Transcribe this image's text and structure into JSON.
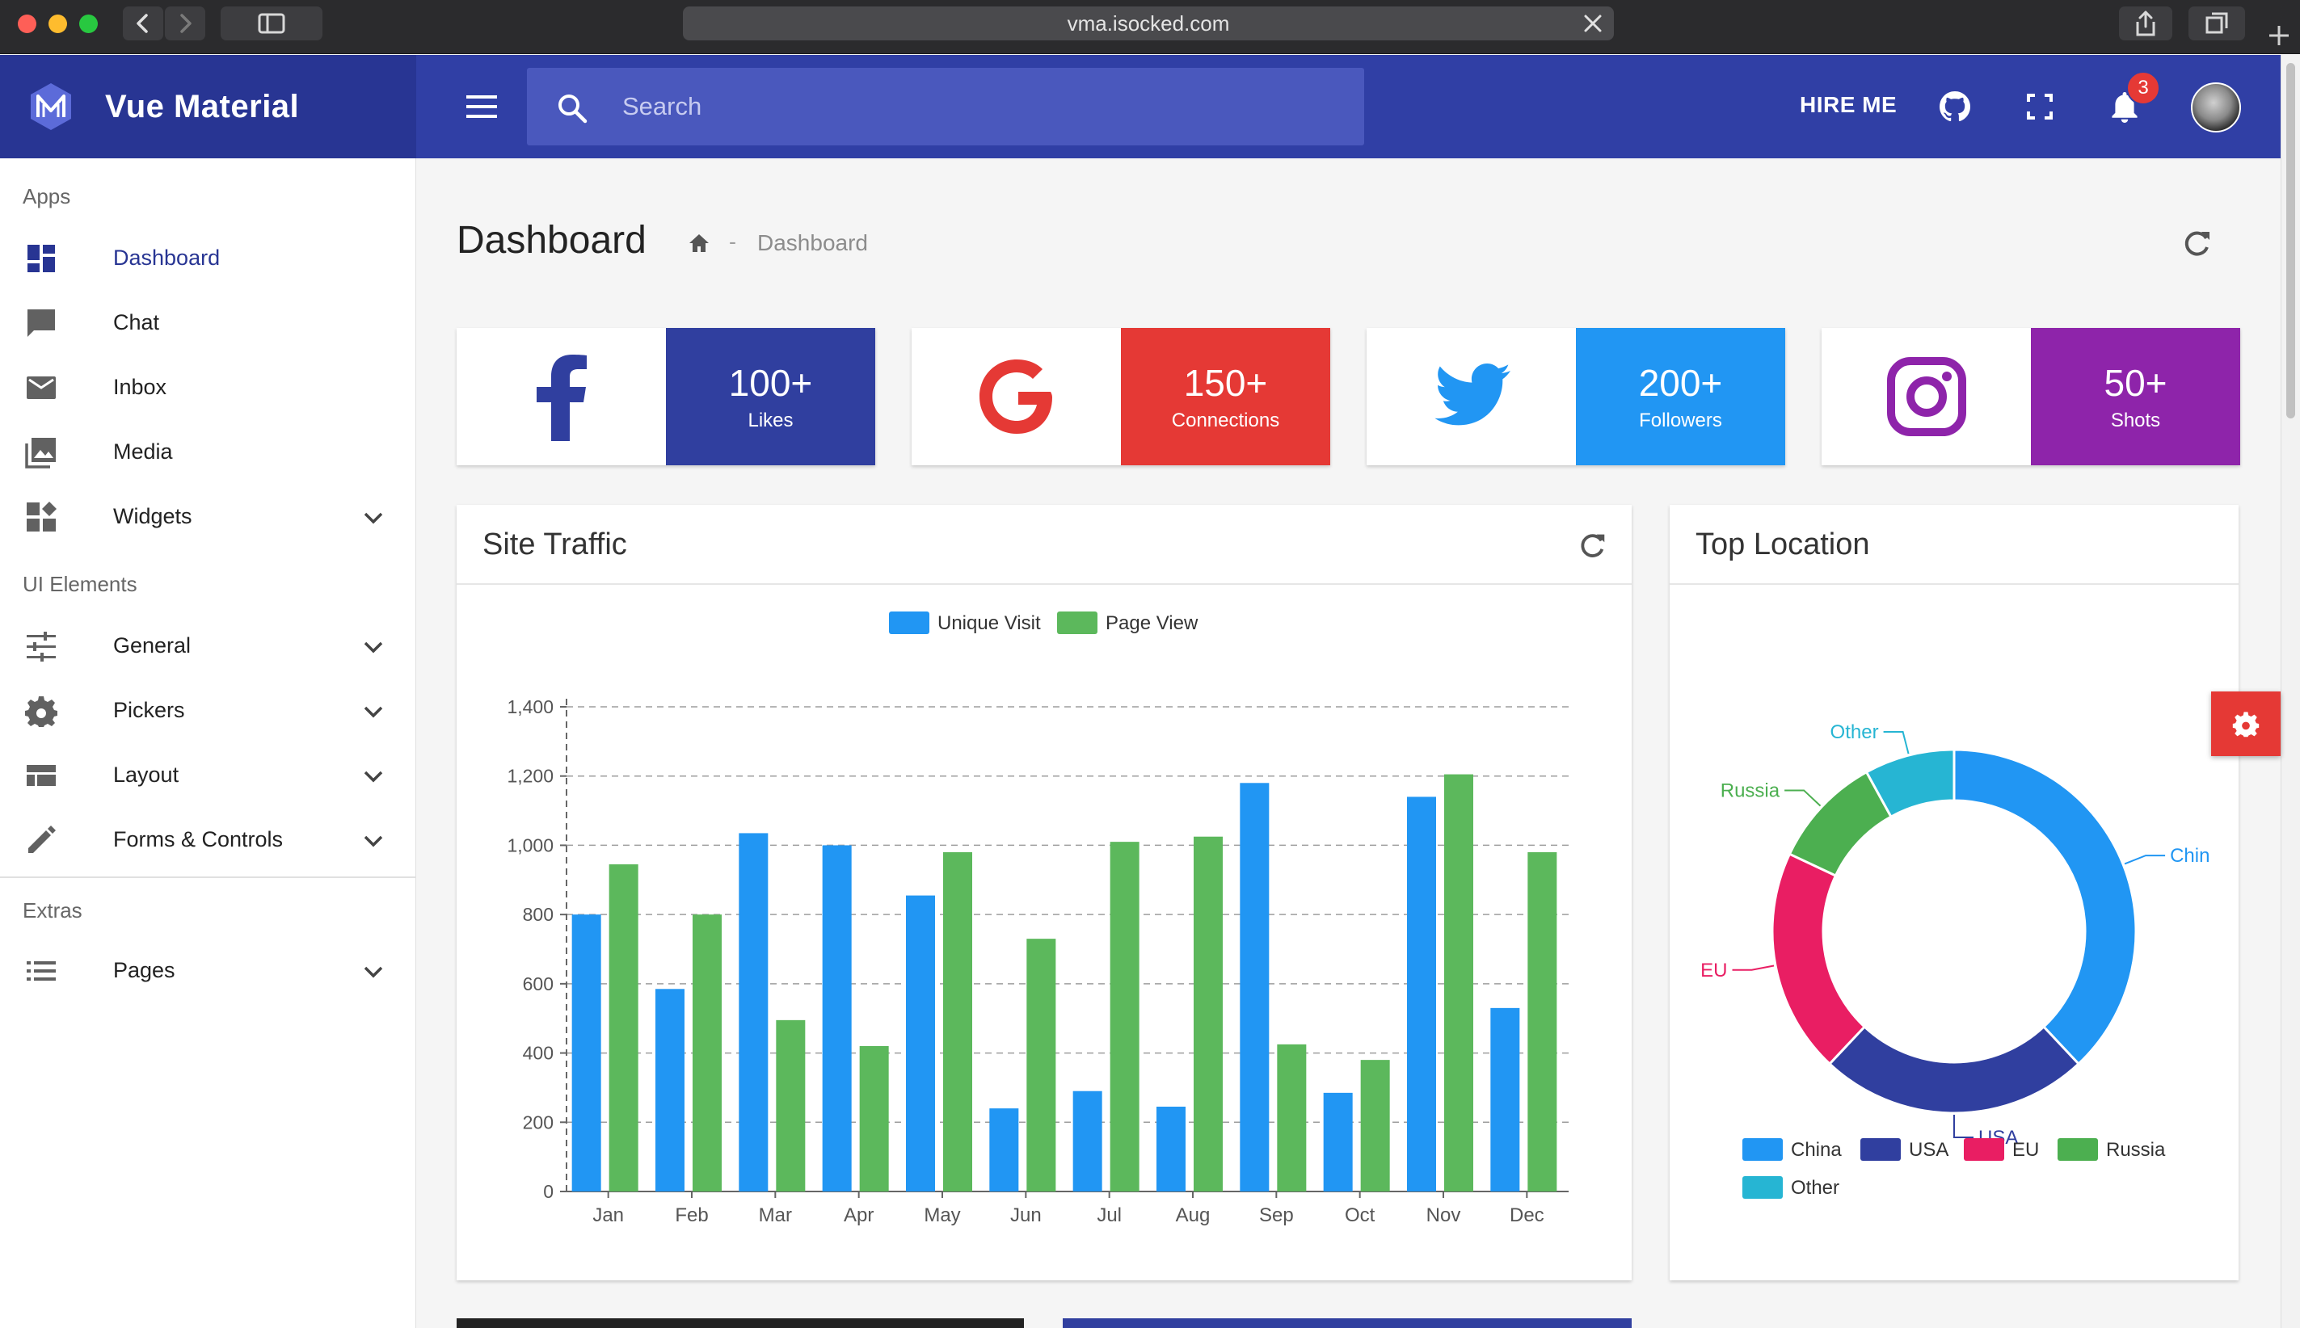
{
  "browser": {
    "url": "vma.isocked.com"
  },
  "brand": {
    "name": "Vue Material"
  },
  "header": {
    "search_placeholder": "Search",
    "hire_me": "HIRE ME",
    "notification_count": "3"
  },
  "sidebar": {
    "sections": [
      {
        "title": "Apps",
        "items": [
          {
            "label": "Dashboard",
            "icon": "dashboard-icon",
            "active": true
          },
          {
            "label": "Chat",
            "icon": "chat-icon"
          },
          {
            "label": "Inbox",
            "icon": "mail-icon"
          },
          {
            "label": "Media",
            "icon": "photo-library-icon"
          },
          {
            "label": "Widgets",
            "icon": "widgets-icon",
            "expandable": true
          }
        ]
      },
      {
        "title": "UI Elements",
        "items": [
          {
            "label": "General",
            "icon": "tune-icon",
            "expandable": true
          },
          {
            "label": "Pickers",
            "icon": "settings-gear-icon",
            "expandable": true
          },
          {
            "label": "Layout",
            "icon": "view-list-icon",
            "expandable": true
          },
          {
            "label": "Forms & Controls",
            "icon": "pencil-icon",
            "expandable": true
          }
        ]
      },
      {
        "title": "Extras",
        "items": [
          {
            "label": "Pages",
            "icon": "list-icon",
            "expandable": true
          }
        ]
      }
    ]
  },
  "page": {
    "title": "Dashboard",
    "breadcrumb_sep": "-",
    "breadcrumb_current": "Dashboard"
  },
  "stats": [
    {
      "network": "facebook",
      "icon": "facebook-icon",
      "value": "100+",
      "label": "Likes",
      "color": "#303f9f",
      "icon_color": "#303f9f"
    },
    {
      "network": "google",
      "icon": "google-icon",
      "value": "150+",
      "label": "Connections",
      "color": "#e53935",
      "icon_color": "#e53935"
    },
    {
      "network": "twitter",
      "icon": "twitter-icon",
      "value": "200+",
      "label": "Followers",
      "color": "#2196f3",
      "icon_color": "#2196f3"
    },
    {
      "network": "instagram",
      "icon": "instagram-icon",
      "value": "50+",
      "label": "Shots",
      "color": "#8e24aa",
      "icon_color": "#8e24aa"
    }
  ],
  "site_traffic": {
    "title": "Site Traffic"
  },
  "top_location": {
    "title": "Top Location"
  },
  "colors": {
    "primary": "#283593",
    "header": "#303fa5",
    "unique_visit": "#2196f3",
    "page_view": "#5cb85c",
    "china": "#2196f3",
    "usa": "#303f9f",
    "eu": "#e91e63",
    "russia": "#4caf50",
    "other": "#26b5d3"
  },
  "chart_data": [
    {
      "type": "bar",
      "categories": [
        "Jan",
        "Feb",
        "Mar",
        "Apr",
        "May",
        "Jun",
        "Jul",
        "Aug",
        "Sep",
        "Oct",
        "Nov",
        "Dec"
      ],
      "series": [
        {
          "name": "Unique Visit",
          "values": [
            800,
            585,
            1035,
            1000,
            855,
            240,
            290,
            245,
            1180,
            285,
            1140,
            530
          ]
        },
        {
          "name": "Page View",
          "values": [
            945,
            800,
            495,
            420,
            980,
            730,
            1010,
            1025,
            425,
            380,
            1205,
            980
          ]
        }
      ],
      "yticks": [
        "0",
        "200",
        "400",
        "600",
        "800",
        "1,000",
        "1,200",
        "1,400"
      ],
      "ylim": [
        0,
        1400
      ],
      "grid": true,
      "legend": "top-center"
    },
    {
      "type": "pie",
      "variant": "donut",
      "labels": [
        "China",
        "USA",
        "EU",
        "Russia",
        "Other"
      ],
      "callout_labels": [
        "Chin",
        "USA",
        "EU",
        "Russia",
        "Other"
      ],
      "values": [
        38,
        24,
        20,
        10,
        8
      ],
      "legend": "bottom"
    }
  ]
}
